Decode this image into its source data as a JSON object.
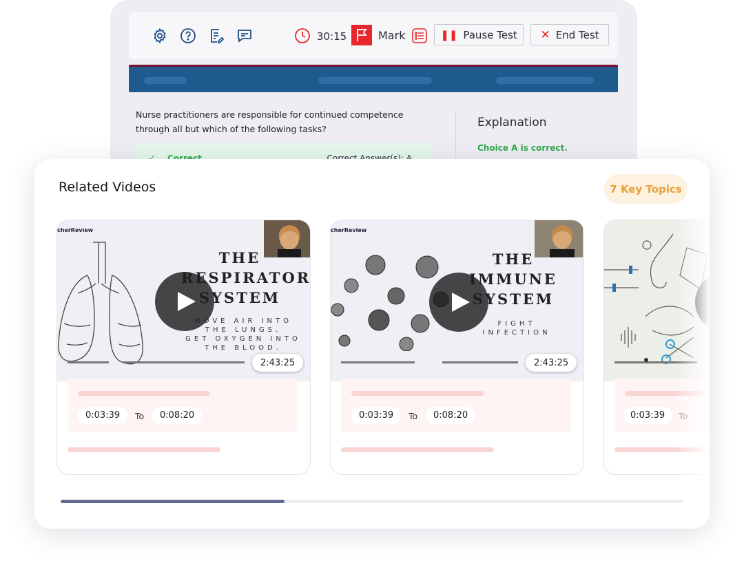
{
  "toolbar": {
    "icons": [
      "gear-icon",
      "help-icon",
      "notes-icon",
      "chat-icon"
    ],
    "timer": "30:15",
    "mark_label": "Mark",
    "pause_label": "Pause Test",
    "end_label": "End Test"
  },
  "question": {
    "text": "Nurse practitioners are responsible for continued competence through all but which of the following tasks?",
    "status": "Correct",
    "correct_answer": "Correct Answer(s): A"
  },
  "explanation": {
    "title": "Explanation",
    "summary": "Choice A is correct."
  },
  "related": {
    "title": "Related Videos",
    "key_topics": "7 Key Topics",
    "scroll_position": 0.36,
    "videos": [
      {
        "title_lines": [
          "THE",
          "RESPIRATORY",
          "SYSTEM"
        ],
        "subtitle": [
          "MOVE AIR INTO",
          "THE LUNGS.",
          "GET OXYGEN INTO",
          "THE BLOOD."
        ],
        "brand": "cherReview",
        "duration": "2:43:25",
        "start": "0:03:39",
        "to": "To",
        "end": "0:08:20"
      },
      {
        "title_lines": [
          "THE",
          "IMMUNE",
          "SYSTEM"
        ],
        "subtitle": [
          "FIGHT",
          "INFECTION"
        ],
        "brand": "cherReview",
        "duration": "2:43:25",
        "start": "0:03:39",
        "to": "To",
        "end": "0:08:20"
      },
      {
        "duration": "",
        "start": "0:03:39",
        "to": "To",
        "end": ""
      }
    ]
  },
  "colors": {
    "accent_blue": "#1e5a8e",
    "flag_red": "#e6282d",
    "correct_green": "#2eaa4a",
    "key_topics_orange": "#e8a23a"
  }
}
